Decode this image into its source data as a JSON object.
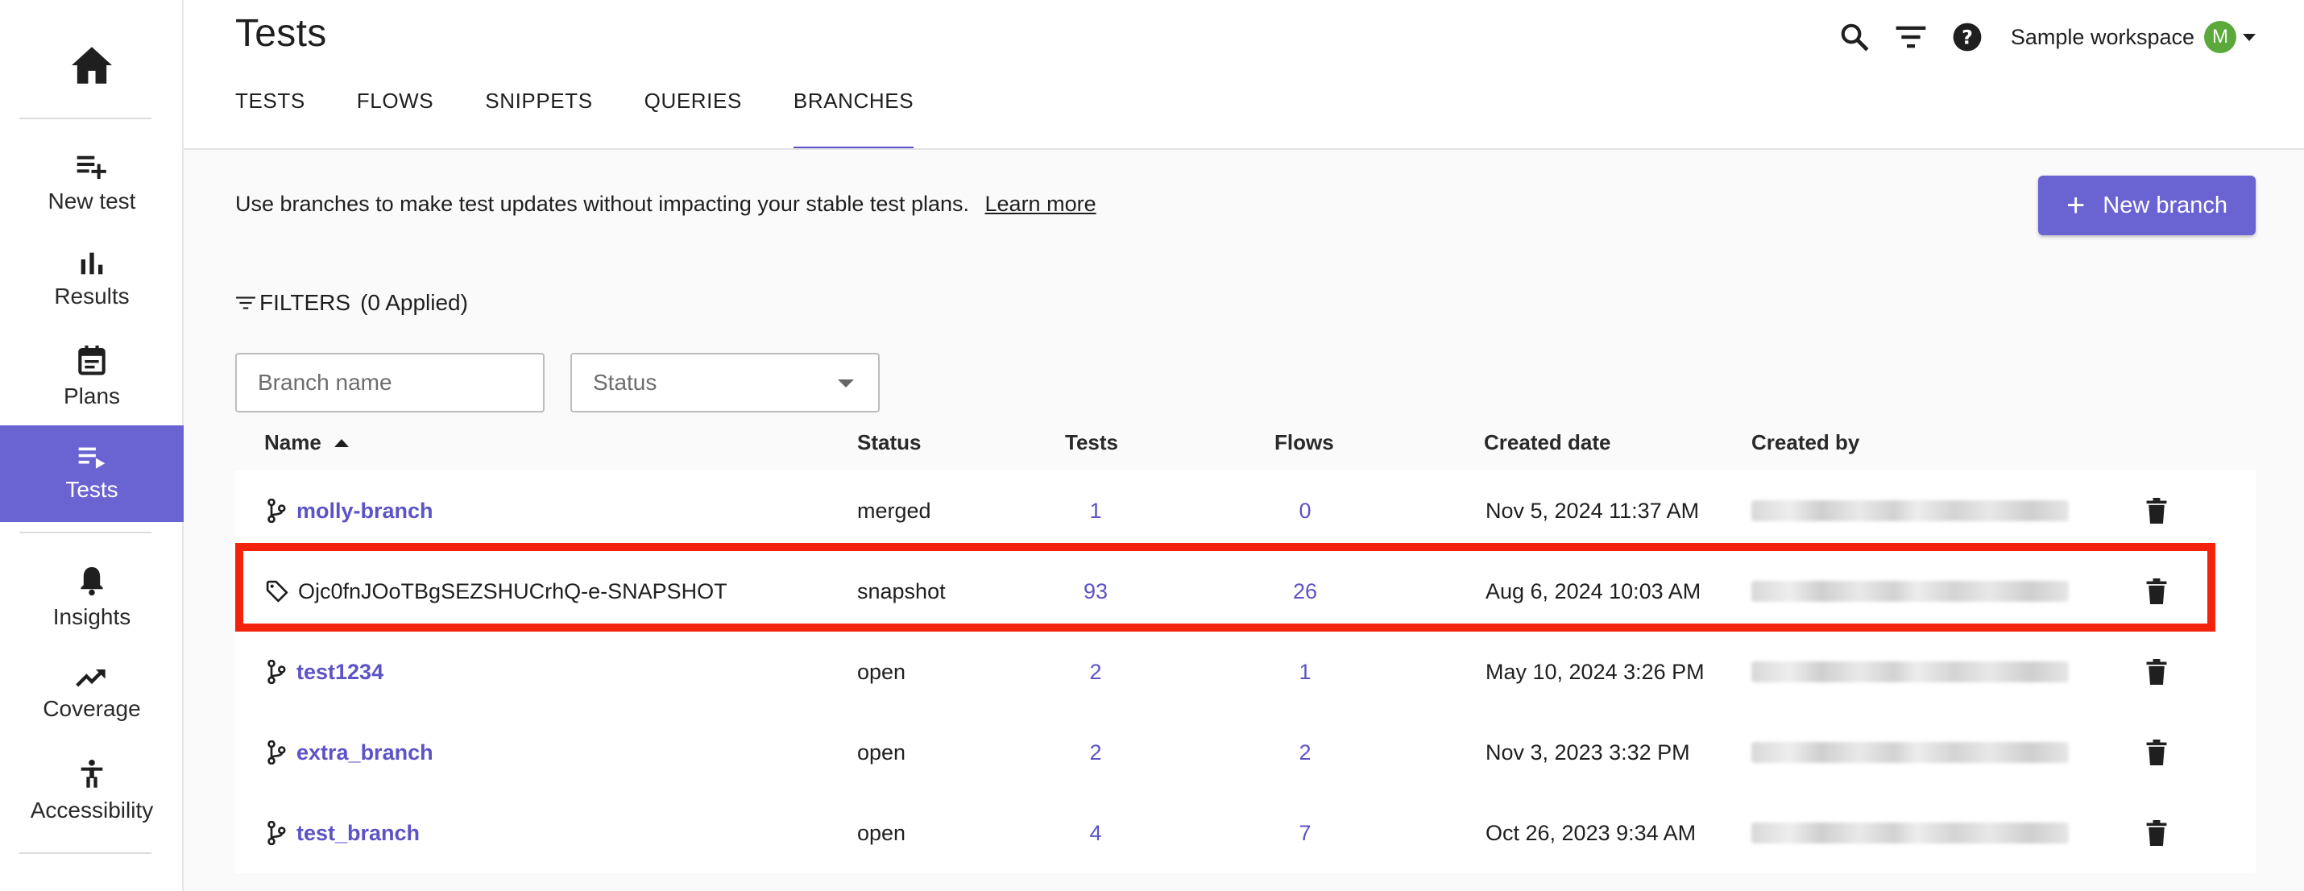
{
  "page": {
    "title": "Tests"
  },
  "sidebar": {
    "home_icon": "home-icon",
    "items": [
      {
        "label": "New test",
        "icon": "playlist-add-icon",
        "active": false
      },
      {
        "label": "Results",
        "icon": "bar-chart-icon",
        "active": false
      },
      {
        "label": "Plans",
        "icon": "calendar-icon",
        "active": false
      },
      {
        "label": "Tests",
        "icon": "playlist-play-icon",
        "active": true
      },
      {
        "label": "Insights",
        "icon": "bell-icon",
        "active": false
      },
      {
        "label": "Coverage",
        "icon": "trending-up-icon",
        "active": false
      },
      {
        "label": "Accessibility",
        "icon": "accessibility-icon",
        "active": false
      }
    ]
  },
  "tabs": [
    {
      "label": "TESTS",
      "active": false
    },
    {
      "label": "FLOWS",
      "active": false
    },
    {
      "label": "SNIPPETS",
      "active": false
    },
    {
      "label": "QUERIES",
      "active": false
    },
    {
      "label": "BRANCHES",
      "active": true
    }
  ],
  "header": {
    "workspace": "Sample workspace",
    "avatar_letter": "M",
    "avatar_color": "#5aa93a"
  },
  "info": {
    "text": "Use branches to make test updates without impacting your stable test plans.",
    "link": "Learn more"
  },
  "new_branch_button": "New branch",
  "filters": {
    "label": "FILTERS",
    "applied": "(0 Applied)",
    "branch_placeholder": "Branch name",
    "status_placeholder": "Status"
  },
  "table": {
    "columns": {
      "name": "Name",
      "status": "Status",
      "tests": "Tests",
      "flows": "Flows",
      "created_date": "Created date",
      "created_by": "Created by"
    },
    "rows": [
      {
        "name": "molly-branch",
        "type": "branch",
        "status": "merged",
        "tests": "1",
        "flows": "0",
        "date": "Nov 5, 2024 11:37 AM"
      },
      {
        "name": "Ojc0fnJOoTBgSEZSHUCrhQ-e-SNAPSHOT",
        "type": "snapshot",
        "status": "snapshot",
        "tests": "93",
        "flows": "26",
        "date": "Aug 6, 2024 10:03 AM"
      },
      {
        "name": "test1234",
        "type": "branch",
        "status": "open",
        "tests": "2",
        "flows": "1",
        "date": "May 10, 2024 3:26 PM"
      },
      {
        "name": "extra_branch",
        "type": "branch",
        "status": "open",
        "tests": "2",
        "flows": "2",
        "date": "Nov 3, 2023 3:32 PM"
      },
      {
        "name": "test_branch",
        "type": "branch",
        "status": "open",
        "tests": "4",
        "flows": "7",
        "date": "Oct 26, 2023 9:34 AM"
      }
    ]
  },
  "colors": {
    "accent": "#6a63d2",
    "link": "#5b53c6",
    "highlight": "#f2220c"
  }
}
